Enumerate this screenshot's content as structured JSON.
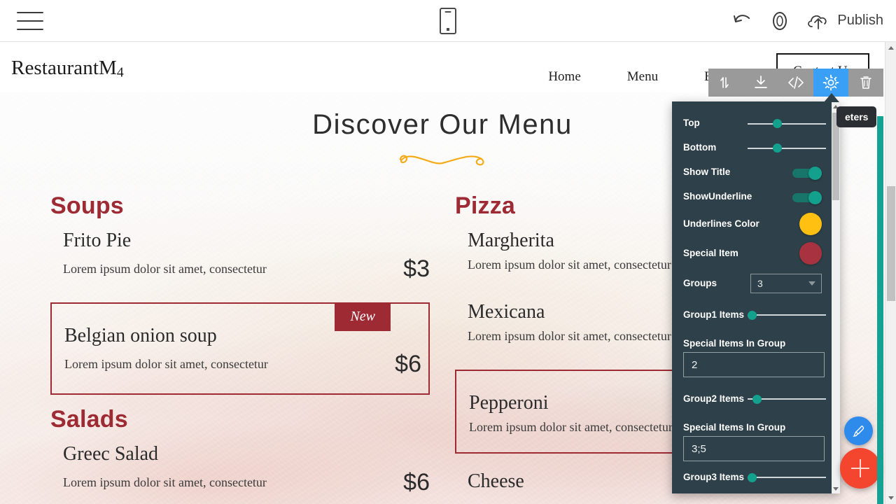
{
  "topbar": {
    "menu_icon": "hamburger-icon",
    "device_icon": "mobile-phone-icon",
    "undo_icon": "undo-arrow-icon",
    "preview_icon": "eye-preview-icon",
    "publish_icon": "cloud-upload-icon",
    "publish_label": "Publish"
  },
  "site": {
    "logo": "RestaurantM",
    "logo_sub": "4",
    "nav": [
      {
        "label": "Home"
      },
      {
        "label": "Menu"
      },
      {
        "label": "Blog"
      }
    ],
    "contact_button": "Contact Us"
  },
  "menu_block": {
    "title": "Discover Our Menu",
    "underline_color": "#f5ab18",
    "groups": [
      {
        "name": "Soups",
        "items": [
          {
            "name": "Frito Pie",
            "desc": "Lorem ipsum dolor sit amet, consectetur",
            "price": "$3",
            "special": false,
            "badge": ""
          },
          {
            "name": "Belgian onion soup",
            "desc": "Lorem ipsum dolor sit amet, consectetur",
            "price": "$6",
            "special": true,
            "badge": "New"
          }
        ]
      },
      {
        "name": "Salads",
        "items": [
          {
            "name": "Greec Salad",
            "desc": "Lorem ipsum dolor sit amet, consectetur",
            "price": "$6",
            "special": false,
            "badge": ""
          }
        ]
      },
      {
        "name": "Pizza",
        "items": [
          {
            "name": "Margherita",
            "desc": "Lorem ipsum dolor sit amet, consectetur",
            "price": "",
            "special": false,
            "badge": ""
          },
          {
            "name": "Mexicana",
            "desc": "Lorem ipsum dolor sit amet, consectetur",
            "price": "",
            "special": false,
            "badge": ""
          },
          {
            "name": "Pepperoni",
            "desc": "Lorem ipsum dolor sit amet, consectetur",
            "price": "",
            "special": true,
            "badge": ""
          },
          {
            "name": "Cheese",
            "desc": "",
            "price": "",
            "special": false,
            "badge": ""
          }
        ]
      }
    ]
  },
  "block_toolbar": {
    "buttons": [
      {
        "icon": "move-up-down-icon",
        "active": false
      },
      {
        "icon": "download-icon",
        "active": false
      },
      {
        "icon": "code-brackets-icon",
        "active": false
      },
      {
        "icon": "gear-settings-icon",
        "active": true
      },
      {
        "icon": "trash-delete-icon",
        "active": false
      }
    ]
  },
  "settings": {
    "tooltip": "eters",
    "rows": [
      {
        "label": "Top",
        "type": "slider",
        "value": 35
      },
      {
        "label": "Bottom",
        "type": "slider",
        "value": 35
      },
      {
        "label": "Show Title",
        "type": "toggle",
        "value": "on"
      },
      {
        "label": "ShowUnderline",
        "type": "toggle",
        "value": "on"
      },
      {
        "label": "Underlines Color",
        "type": "color",
        "value": "#ffc012"
      },
      {
        "label": "Special Item",
        "type": "color",
        "value": "#a8323f"
      },
      {
        "label": "Groups",
        "type": "select",
        "value": "3"
      },
      {
        "label": "Group1 Items",
        "type": "slider",
        "value": 2
      },
      {
        "label": "Special Items In Group",
        "type": "text",
        "value": "2"
      },
      {
        "label": "Group2 Items",
        "type": "slider",
        "value": 8
      },
      {
        "label": "Special Items In Group",
        "type": "text",
        "value": "3;5"
      },
      {
        "label": "Group3 Items",
        "type": "slider",
        "value": 8
      }
    ]
  },
  "fabs": {
    "brush_icon": "paintbrush-icon",
    "add_icon": "plus-add-icon"
  },
  "colors": {
    "panel_bg": "#2e4049",
    "accent_teal": "#13a08c",
    "accent_blue": "#3aa0f5",
    "brand_red": "#9e2a34",
    "fab_red": "#f4452e",
    "fab_blue": "#2e8bec"
  }
}
